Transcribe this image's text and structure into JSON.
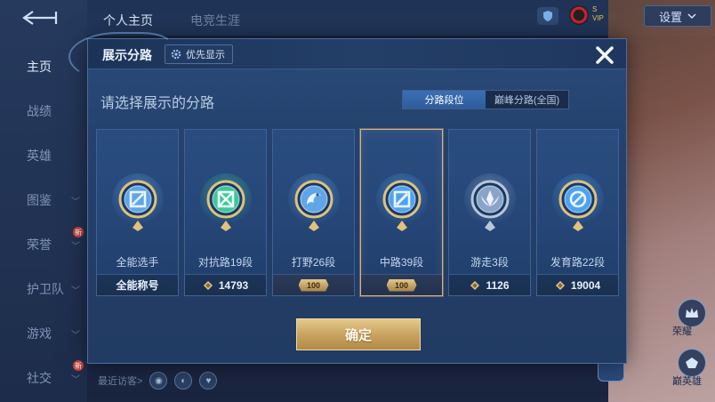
{
  "background": {
    "top_tabs": [
      {
        "label": "个人主页"
      },
      {
        "label": "电竞生涯"
      }
    ],
    "settings_label": "设置",
    "top_mini_text": [
      "S",
      "VIP"
    ],
    "sidebar": {
      "items": [
        {
          "label": "主页",
          "active": true
        },
        {
          "label": "战绩"
        },
        {
          "label": "英雄"
        },
        {
          "label": "图鉴"
        },
        {
          "label": "荣誉"
        },
        {
          "label": "护卫队"
        },
        {
          "label": "游戏"
        },
        {
          "label": "社交"
        }
      ],
      "new_badge": "新"
    },
    "bottom_bar": {
      "recent_visitors": "最近访客>"
    },
    "right_buttons": [
      {
        "label": "荣耀"
      },
      {
        "label": "巅英雄"
      }
    ]
  },
  "dialog": {
    "title": "展示分路",
    "priority_button": "优先显示",
    "subtitle": "请选择展示的分路",
    "toggle": {
      "options": [
        {
          "label": "分路段位",
          "selected": true
        },
        {
          "label": "巅峰分路(全国)",
          "selected": false
        }
      ]
    },
    "cards": [
      {
        "name": "全能选手",
        "footer": "全能称号",
        "footer_type": "title",
        "emblem": "all-round-emblem",
        "emblem_color": "#5ea6e8"
      },
      {
        "name": "对抗路19段",
        "footer": "14793",
        "footer_type": "points",
        "emblem": "clash-lane-emblem",
        "emblem_color": "#3ec79a"
      },
      {
        "name": "打野26段",
        "footer": "100",
        "footer_type": "crown",
        "emblem": "jungle-emblem",
        "emblem_color": "#5ea6e8"
      },
      {
        "name": "中路39段",
        "footer": "100",
        "footer_type": "crown",
        "emblem": "mid-lane-emblem",
        "emblem_color": "#4fa2f0",
        "selected": true
      },
      {
        "name": "游走3段",
        "footer": "1126",
        "footer_type": "points",
        "emblem": "roam-emblem",
        "emblem_color": "#8aa4c8"
      },
      {
        "name": "发育路22段",
        "footer": "19004",
        "footer_type": "points",
        "emblem": "farm-lane-emblem",
        "emblem_color": "#4fa2f0"
      }
    ],
    "confirm_label": "确定"
  },
  "colors": {
    "accent_gold": "#d9b27d",
    "toggle_active": "#3b6fb5",
    "dialog_bg": "#24406b"
  }
}
